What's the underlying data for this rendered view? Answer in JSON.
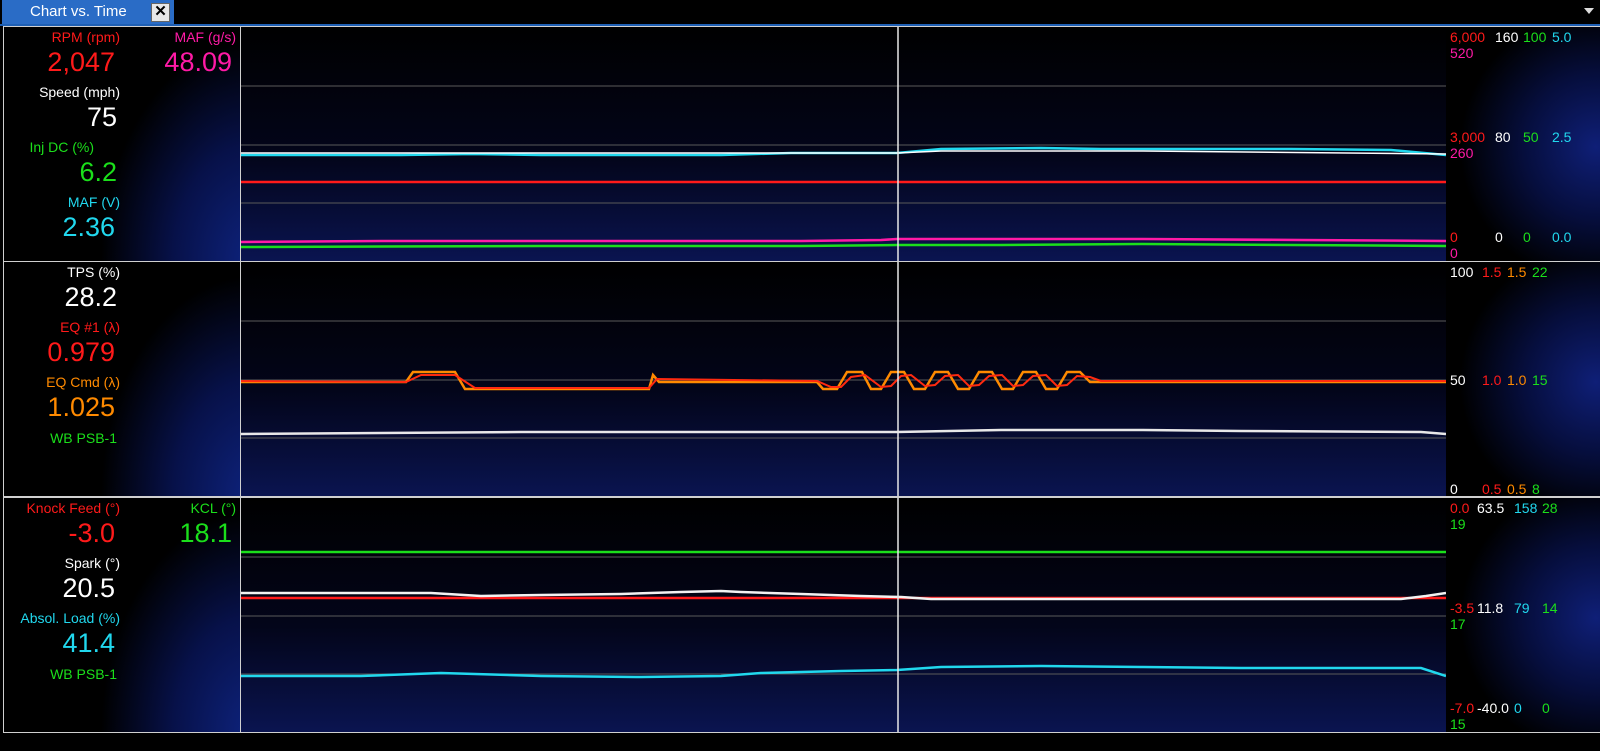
{
  "window": {
    "tab_title": "Chart vs. Time",
    "close_glyph": "✕"
  },
  "colors": {
    "red": "#ff1a1a",
    "magenta": "#ff1aa6",
    "white": "#ffffff",
    "green": "#1bdf1b",
    "cyan": "#21d8ee",
    "orange": "#ff8a00",
    "tab": "#2a6cc6"
  },
  "panels": [
    {
      "channels": [
        {
          "label": "RPM (rpm)",
          "value": "2,047",
          "color": "#ff1a1a"
        },
        {
          "label": "MAF (g/s)",
          "value": "48.09",
          "color": "#ff1aa6"
        },
        {
          "label": "Speed (mph)",
          "value": "75",
          "color": "#ffffff"
        },
        {
          "label": "Inj DC (%)",
          "value": "6.2",
          "color": "#1bdf1b"
        },
        {
          "label": "MAF (V)",
          "value": "2.36",
          "color": "#21d8ee"
        }
      ],
      "axis_ticks": {
        "top": {
          "rpm": "6,000",
          "maf": "520",
          "speed": "160",
          "inj": "100",
          "mafv": "5.0"
        },
        "middle": {
          "rpm": "3,000",
          "maf": "260",
          "speed": "80",
          "inj": "50",
          "mafv": "2.5"
        },
        "bottom": {
          "rpm": "0",
          "maf": "0",
          "speed": "0",
          "inj": "0",
          "mafv": "0.0"
        }
      }
    },
    {
      "channels": [
        {
          "label": "TPS (%)",
          "value": "28.2",
          "color": "#ffffff"
        },
        {
          "label": "EQ #1 (λ)",
          "value": "0.979",
          "color": "#ff1a1a"
        },
        {
          "label": "EQ Cmd (λ)",
          "value": "1.025",
          "color": "#ff8a00"
        },
        {
          "label": "WB PSB-1",
          "value": "",
          "color": "#1bdf1b"
        }
      ],
      "axis_ticks": {
        "top": {
          "tps": "100",
          "eq1": "1.5",
          "eqcmd": "1.5",
          "wb": "22"
        },
        "middle": {
          "tps": "50",
          "eq1": "1.0",
          "eqcmd": "1.0",
          "wb": "15"
        },
        "bottom": {
          "tps": "0",
          "eq1": "0.5",
          "eqcmd": "0.5",
          "wb": "8"
        }
      }
    },
    {
      "channels": [
        {
          "label": "Knock Feed (°)",
          "value": "-3.0",
          "color": "#ff1a1a"
        },
        {
          "label": "KCL (°)",
          "value": "18.1",
          "color": "#1bdf1b"
        },
        {
          "label": "Spark (°)",
          "value": "20.5",
          "color": "#ffffff"
        },
        {
          "label": "Absol. Load (%)",
          "value": "41.4",
          "color": "#21d8ee"
        },
        {
          "label": "WB PSB-1",
          "value": "",
          "color": "#1bdf1b"
        }
      ],
      "axis_ticks": {
        "top": {
          "knock": "0.0",
          "spark": "63.5",
          "load": "158",
          "kcl": "28",
          "wb": "19"
        },
        "middle": {
          "knock": "-3.5",
          "spark": "11.8",
          "load": "79",
          "kcl": "14",
          "wb": "17"
        },
        "bottom": {
          "knock": "-7.0",
          "spark": "-40.0",
          "load": "0",
          "kcl": "0",
          "wb": "15"
        }
      }
    }
  ]
}
